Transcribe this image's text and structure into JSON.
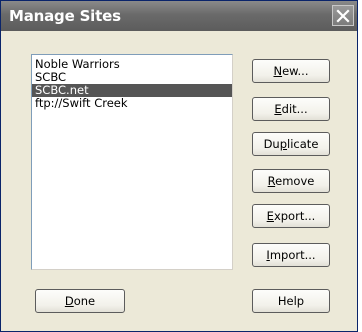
{
  "window": {
    "title": "Manage Sites",
    "close_glyph": "✕"
  },
  "sites": [
    {
      "label": "Noble Warriors",
      "selected": false
    },
    {
      "label": "SCBC",
      "selected": false
    },
    {
      "label": "SCBC.net",
      "selected": true
    },
    {
      "label": "ftp://Swift Creek",
      "selected": false
    }
  ],
  "buttons": {
    "new": {
      "pre": "",
      "key": "N",
      "post": "ew..."
    },
    "edit": {
      "pre": "",
      "key": "E",
      "post": "dit..."
    },
    "duplicate": {
      "pre": "Du",
      "key": "p",
      "post": "licate"
    },
    "remove": {
      "pre": "",
      "key": "R",
      "post": "emove"
    },
    "export": {
      "pre": "",
      "key": "E",
      "post": "xport..."
    },
    "import": {
      "pre": "",
      "key": "I",
      "post": "mport..."
    },
    "done": {
      "pre": "",
      "key": "D",
      "post": "one"
    },
    "help": {
      "label": "Help"
    }
  }
}
